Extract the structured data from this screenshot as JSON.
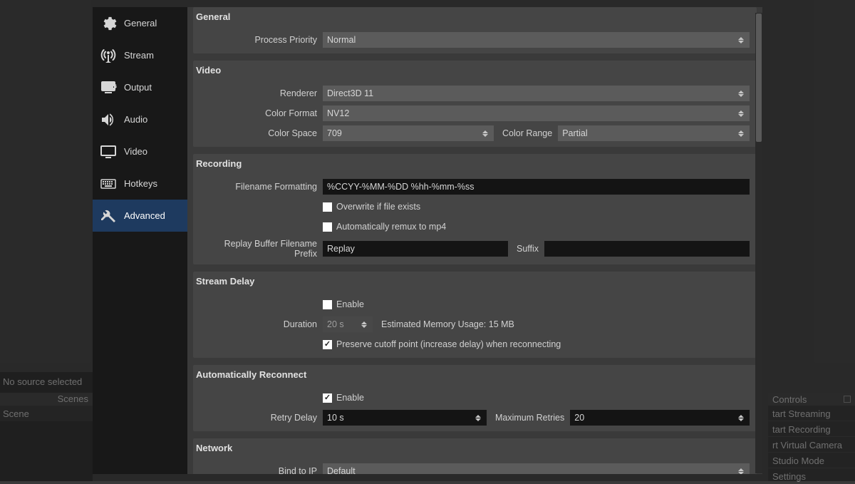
{
  "background": {
    "no_source": "No source selected",
    "scenes_header": "Scenes",
    "scene": "Scene",
    "controls": {
      "header": "Controls",
      "items": [
        "tart Streaming",
        "tart Recording",
        "rt Virtual Camera",
        "Studio Mode",
        "Settings"
      ]
    }
  },
  "sidebar": {
    "items": [
      {
        "label": "General"
      },
      {
        "label": "Stream"
      },
      {
        "label": "Output"
      },
      {
        "label": "Audio"
      },
      {
        "label": "Video"
      },
      {
        "label": "Hotkeys"
      },
      {
        "label": "Advanced"
      }
    ]
  },
  "general": {
    "title": "General",
    "process_priority": {
      "label": "Process Priority",
      "value": "Normal"
    }
  },
  "video": {
    "title": "Video",
    "renderer": {
      "label": "Renderer",
      "value": "Direct3D 11"
    },
    "color_format": {
      "label": "Color Format",
      "value": "NV12"
    },
    "color_space": {
      "label": "Color Space",
      "value": "709"
    },
    "color_range": {
      "label": "Color Range",
      "value": "Partial"
    }
  },
  "recording": {
    "title": "Recording",
    "filename_formatting": {
      "label": "Filename Formatting",
      "value": "%CCYY-%MM-%DD %hh-%mm-%ss"
    },
    "overwrite": "Overwrite if file exists",
    "auto_remux": "Automatically remux to mp4",
    "replay_prefix_label": "Replay Buffer Filename Prefix",
    "replay_prefix_value": "Replay",
    "suffix_label": "Suffix",
    "suffix_value": ""
  },
  "stream_delay": {
    "title": "Stream Delay",
    "enable": "Enable",
    "duration_label": "Duration",
    "duration_value": "20 s",
    "memory": "Estimated Memory Usage: 15 MB",
    "preserve": "Preserve cutoff point (increase delay) when reconnecting"
  },
  "auto_reconnect": {
    "title": "Automatically Reconnect",
    "enable": "Enable",
    "retry_delay_label": "Retry Delay",
    "retry_delay_value": "10 s",
    "max_retries_label": "Maximum Retries",
    "max_retries_value": "20"
  },
  "network": {
    "title": "Network",
    "bind_label": "Bind to IP",
    "bind_value": "Default"
  }
}
